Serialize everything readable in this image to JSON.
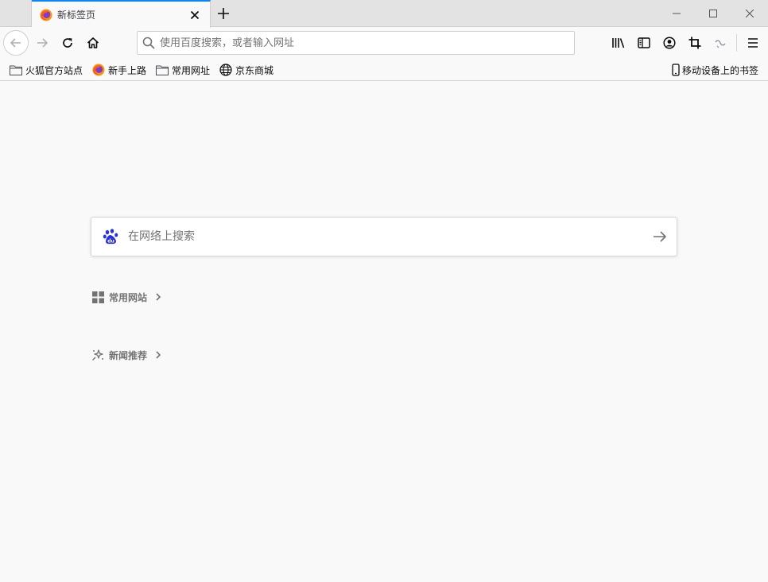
{
  "tab": {
    "title": "新标签页"
  },
  "urlbar": {
    "placeholder": "使用百度搜索，或者输入网址"
  },
  "bookmarks": [
    {
      "label": "火狐官方站点",
      "icon": "folder-icon"
    },
    {
      "label": "新手上路",
      "icon": "firefox-icon"
    },
    {
      "label": "常用网址",
      "icon": "folder-icon"
    },
    {
      "label": "京东商城",
      "icon": "globe-icon"
    }
  ],
  "mobile_bookmarks": {
    "label": "移动设备上的书签"
  },
  "content": {
    "search_placeholder": "在网络上搜索",
    "top_sites_label": "常用网站",
    "news_label": "新闻推荐"
  },
  "colors": {
    "accent": "#0a84ff",
    "baidu_blue": "#2932e1"
  }
}
